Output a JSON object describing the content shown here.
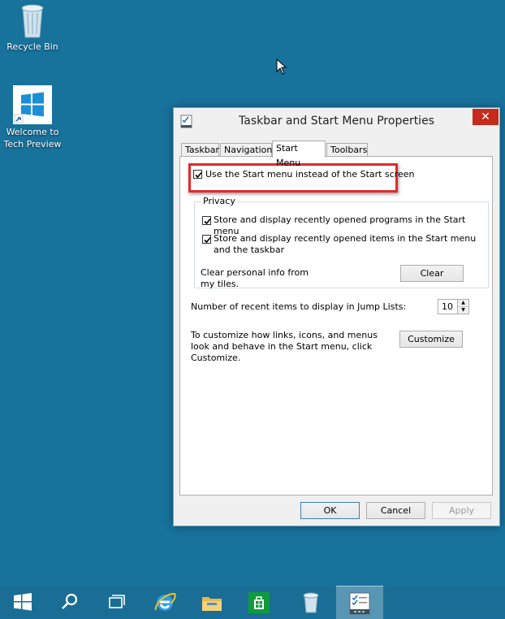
{
  "desktop": {
    "icons": [
      {
        "label": "Recycle Bin"
      },
      {
        "label": "Welcome to Tech Preview"
      }
    ]
  },
  "window": {
    "title": "Taskbar and Start Menu Properties",
    "close_glyph": "✕",
    "tabs": [
      {
        "label": "Taskbar"
      },
      {
        "label": "Navigation"
      },
      {
        "label": "Start Menu",
        "active": true
      },
      {
        "label": "Toolbars"
      }
    ],
    "use_start_menu": {
      "label": "Use the Start menu instead of the Start screen",
      "checked": true
    },
    "privacy": {
      "title": "Privacy",
      "store_programs": {
        "label": "Store and display recently opened programs in the Start menu",
        "checked": true
      },
      "store_items": {
        "label": "Store and display recently opened items in the Start menu and the taskbar",
        "checked": true
      },
      "clear_text": "Clear personal info from my tiles.",
      "clear_button": "Clear"
    },
    "jump_lists": {
      "label": "Number of recent items to display in Jump Lists:",
      "value": "10"
    },
    "customize": {
      "text": "To customize how links, icons, and menus look and behave in the Start menu, click Customize.",
      "button": "Customize"
    },
    "buttons": {
      "ok": "OK",
      "cancel": "Cancel",
      "apply": "Apply"
    }
  },
  "taskbar": {
    "items": [
      {
        "icon": "start-icon"
      },
      {
        "icon": "search-icon"
      },
      {
        "icon": "task-view-icon"
      },
      {
        "icon": "internet-explorer-icon"
      },
      {
        "icon": "file-explorer-icon"
      },
      {
        "icon": "store-icon"
      },
      {
        "icon": "recycle-bin-icon"
      },
      {
        "icon": "taskbar-properties-icon",
        "active": true
      }
    ]
  },
  "colors": {
    "desktop": "#17729c",
    "highlight": "#e02b2b",
    "close": "#c42b1c"
  }
}
